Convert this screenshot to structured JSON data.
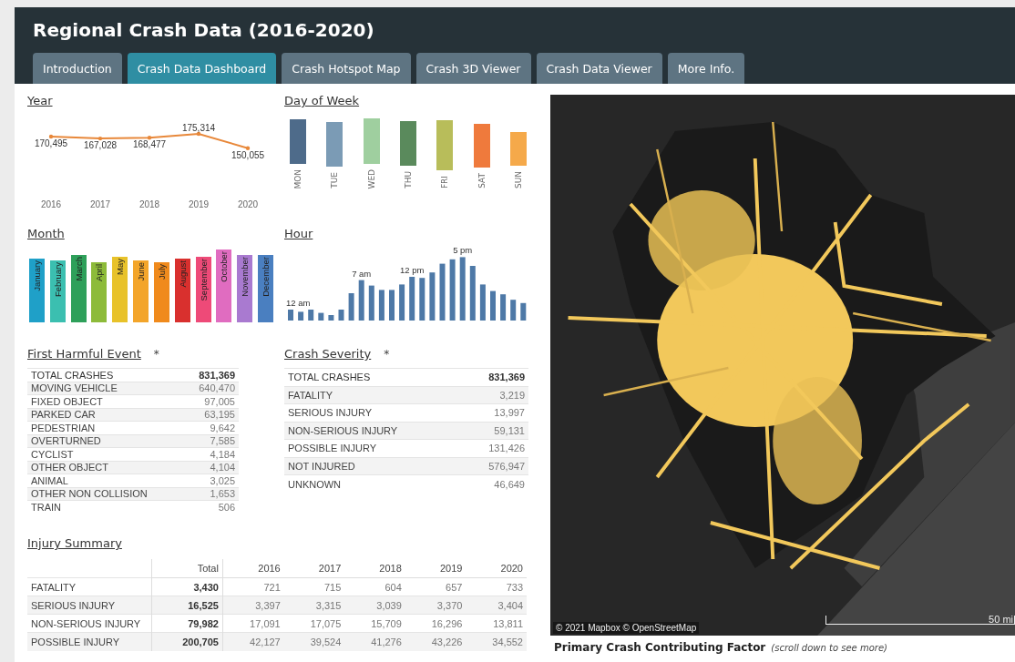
{
  "header": {
    "title": "Regional Crash Data (2016-2020)"
  },
  "tabs": [
    {
      "label": "Introduction",
      "selected": false
    },
    {
      "label": "Crash Data Dashboard",
      "selected": true
    },
    {
      "label": "Crash Hotspot Map",
      "selected": false
    },
    {
      "label": "Crash 3D Viewer",
      "selected": false
    },
    {
      "label": "Crash Data Viewer",
      "selected": false
    },
    {
      "label": "More Info.",
      "selected": false
    }
  ],
  "year": {
    "title": "Year",
    "chart_data": {
      "type": "line",
      "categories": [
        "2016",
        "2017",
        "2018",
        "2019",
        "2020"
      ],
      "series": [
        {
          "color": "#e8883a",
          "values": [
            170495,
            167028,
            168477,
            175314,
            150055
          ],
          "value_labels": [
            "170,495",
            "167,028",
            "168,477",
            "175,314",
            "150,055"
          ]
        }
      ]
    }
  },
  "day_of_week": {
    "title": "Day of Week",
    "bars": [
      {
        "label": "MON",
        "color": "#4e6b8a"
      },
      {
        "label": "TUE",
        "color": "#7b9bb5"
      },
      {
        "label": "WED",
        "color": "#9fcf9f"
      },
      {
        "label": "THU",
        "color": "#5a8a5c"
      },
      {
        "label": "FRI",
        "color": "#b8bd5a"
      },
      {
        "label": "SAT",
        "color": "#ef7a3c"
      },
      {
        "label": "SUN",
        "color": "#f5a94a"
      }
    ]
  },
  "month": {
    "title": "Month",
    "bars": [
      {
        "label": "January",
        "color": "#1fa0c8"
      },
      {
        "label": "February",
        "color": "#3bbfb0"
      },
      {
        "label": "March",
        "color": "#2ea05a"
      },
      {
        "label": "April",
        "color": "#8dbb3a"
      },
      {
        "label": "May",
        "color": "#e8c22a"
      },
      {
        "label": "June",
        "color": "#f3a52a"
      },
      {
        "label": "July",
        "color": "#f08a1c"
      },
      {
        "label": "August",
        "color": "#d9302e"
      },
      {
        "label": "September",
        "color": "#ee4a78"
      },
      {
        "label": "October",
        "color": "#e06cc0"
      },
      {
        "label": "November",
        "color": "#a97ad0"
      },
      {
        "label": "December",
        "color": "#4a7fc0"
      }
    ]
  },
  "hour": {
    "title": "Hour",
    "annotations": [
      "12 am",
      "7 am",
      "12 pm",
      "5 pm"
    ]
  },
  "first_harmful_event": {
    "title": "First Harmful Event",
    "note": "*",
    "rows": [
      {
        "label": "TOTAL CRASHES",
        "value": "831,369",
        "kind": "total"
      },
      {
        "label": "MOVING VEHICLE",
        "value": "640,470",
        "kind": "item"
      },
      {
        "label": "FIXED OBJECT",
        "value": "97,005",
        "kind": "item"
      },
      {
        "label": "PARKED CAR",
        "value": "63,195",
        "kind": "item"
      },
      {
        "label": "PEDESTRIAN",
        "value": "9,642",
        "kind": "item"
      },
      {
        "label": "OVERTURNED",
        "value": "7,585",
        "kind": "item"
      },
      {
        "label": "CYCLIST",
        "value": "4,184",
        "kind": "item"
      },
      {
        "label": "OTHER OBJECT",
        "value": "4,104",
        "kind": "item"
      },
      {
        "label": "ANIMAL",
        "value": "3,025",
        "kind": "item"
      },
      {
        "label": "OTHER NON COLLISION",
        "value": "1,653",
        "kind": "item"
      },
      {
        "label": "TRAIN",
        "value": "506",
        "kind": "item"
      }
    ]
  },
  "crash_severity": {
    "title": "Crash Severity",
    "note": "*",
    "rows": [
      {
        "label": "TOTAL CRASHES",
        "value": "831,369",
        "kind": "total"
      },
      {
        "label": "FATALITY",
        "value": "3,219",
        "kind": "item"
      },
      {
        "label": "SERIOUS INJURY",
        "value": "13,997",
        "kind": "item"
      },
      {
        "label": "NON-SERIOUS INJURY",
        "value": "59,131",
        "kind": "item"
      },
      {
        "label": "POSSIBLE INJURY",
        "value": "131,426",
        "kind": "item"
      },
      {
        "label": "NOT INJURED",
        "value": "576,947",
        "kind": "item"
      },
      {
        "label": "UNKNOWN",
        "value": "46,649",
        "kind": "item"
      }
    ]
  },
  "injury_summary": {
    "title": "Injury Summary",
    "columns": [
      "Total",
      "2016",
      "2017",
      "2018",
      "2019",
      "2020"
    ],
    "rows": [
      {
        "label": "FATALITY",
        "cells": [
          "3,430",
          "721",
          "715",
          "604",
          "657",
          "733"
        ]
      },
      {
        "label": "SERIOUS INJURY",
        "cells": [
          "16,525",
          "3,397",
          "3,315",
          "3,039",
          "3,370",
          "3,404"
        ]
      },
      {
        "label": "NON-SERIOUS INJURY",
        "cells": [
          "79,982",
          "17,091",
          "17,075",
          "15,709",
          "16,296",
          "13,811"
        ]
      },
      {
        "label": "POSSIBLE INJURY",
        "cells": [
          "200,705",
          "42,127",
          "39,524",
          "41,276",
          "43,226",
          "34,552"
        ]
      }
    ]
  },
  "map": {
    "kind": "picture",
    "attribution": "© 2021 Mapbox © OpenStreetMap",
    "scale": "50 mi"
  },
  "next_section": {
    "title": "Primary Crash Contributing Factor",
    "hint": "(scroll down to see more)"
  }
}
